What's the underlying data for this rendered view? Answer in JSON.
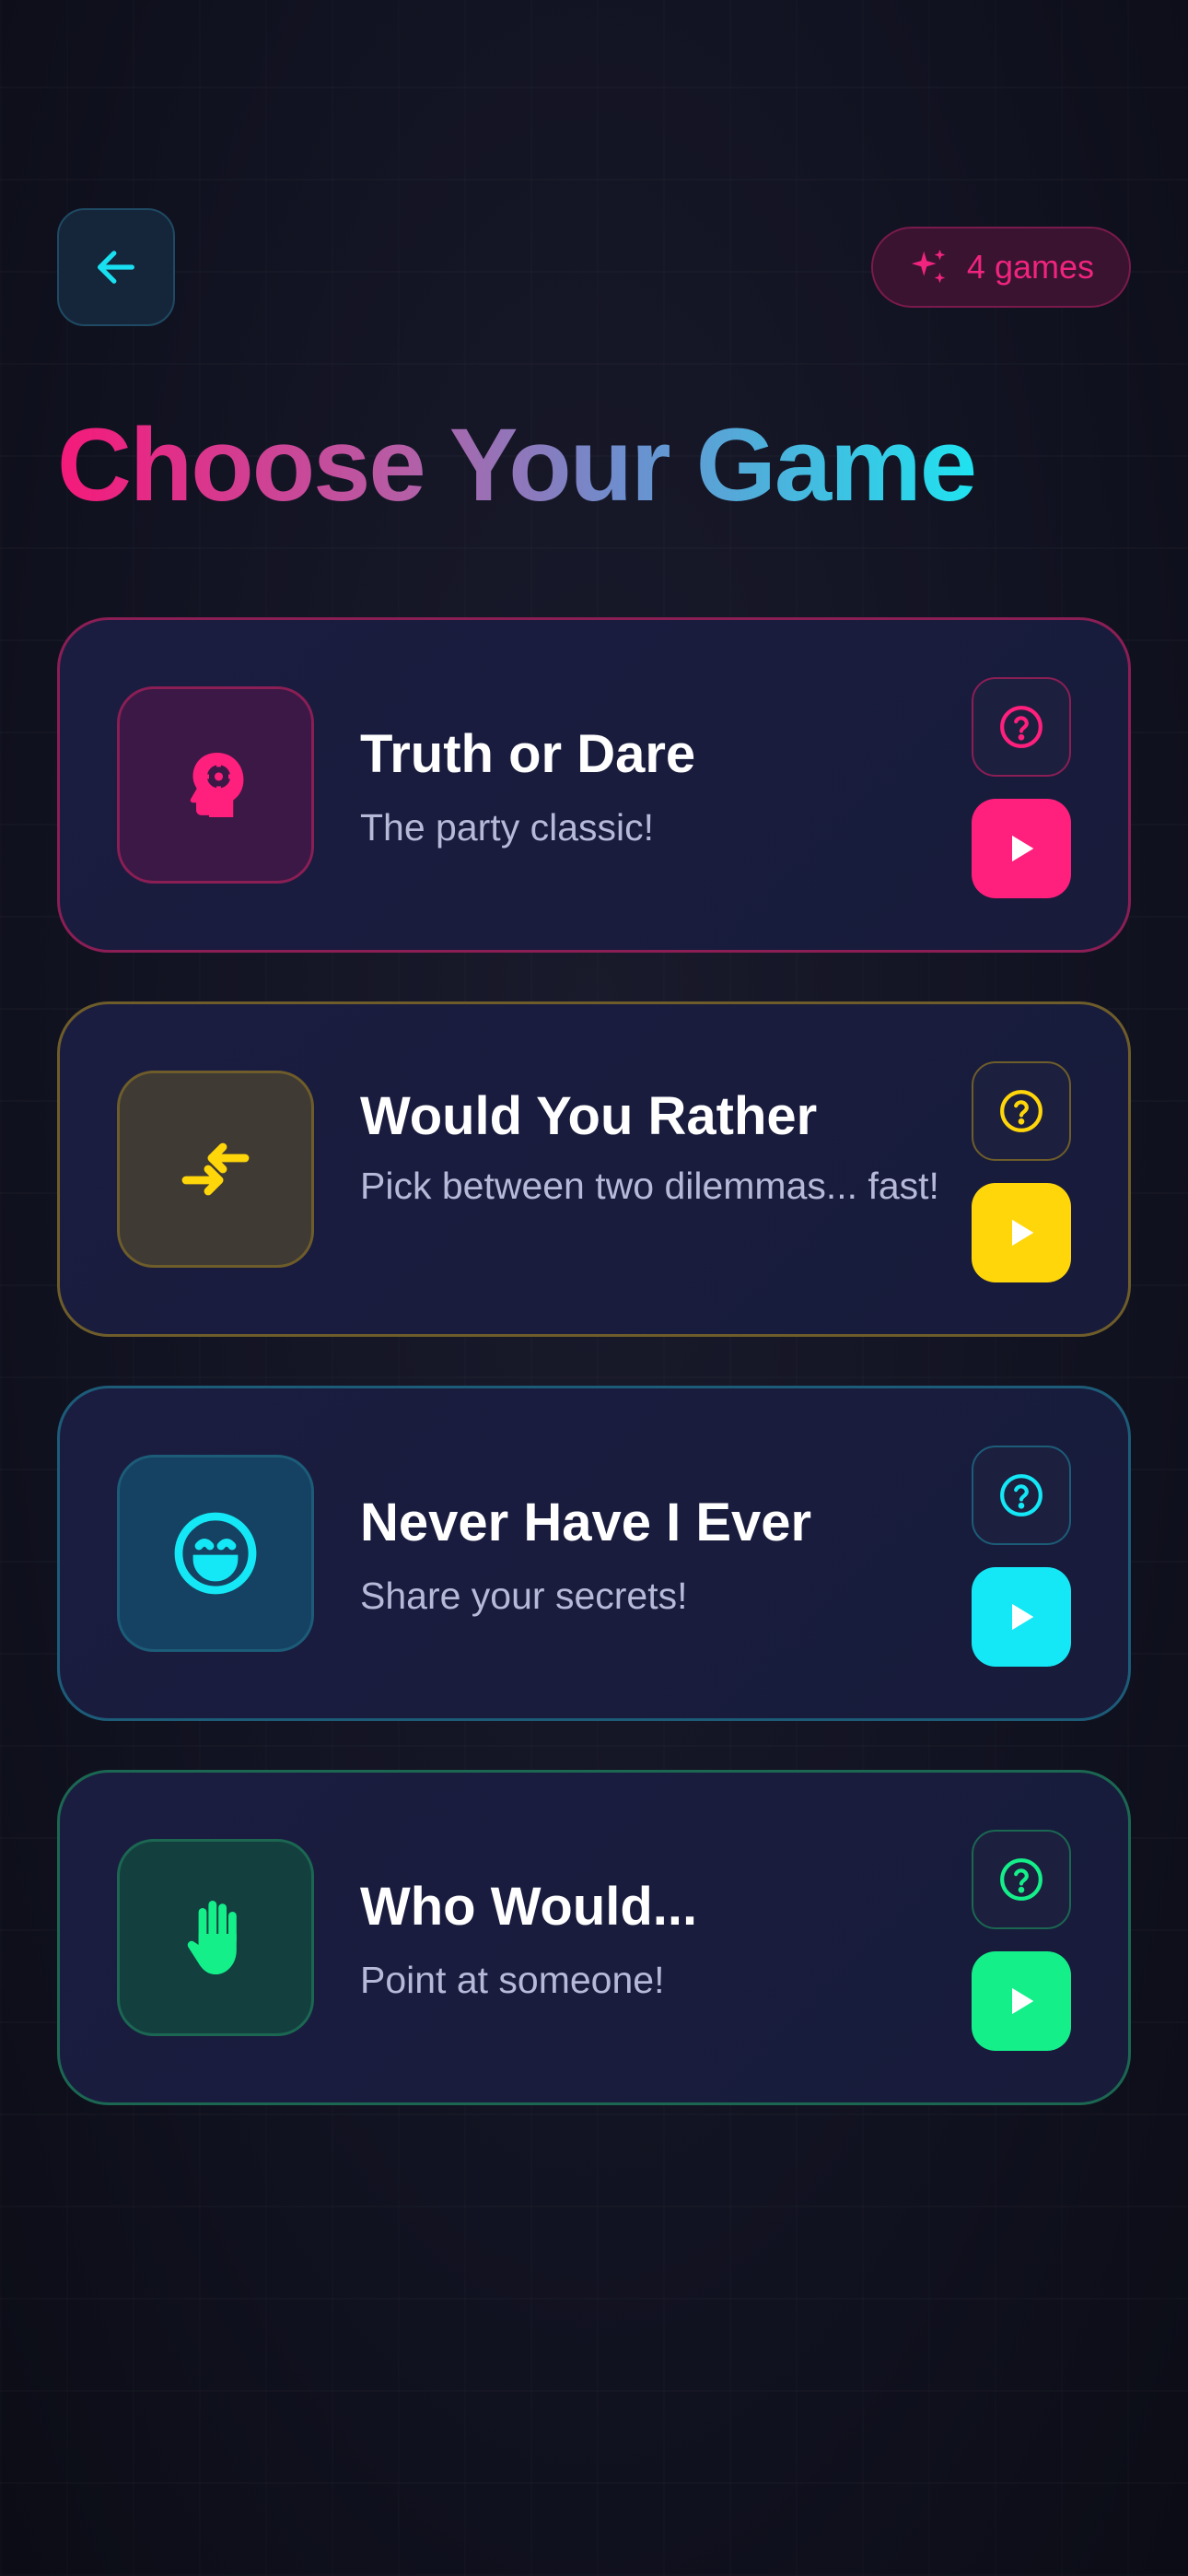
{
  "header": {
    "back_icon": "arrow-left-icon",
    "badge": {
      "icon": "sparkles-icon",
      "label": "4 games"
    },
    "title": "Choose Your Game"
  },
  "games": [
    {
      "title": "Truth or Dare",
      "subtitle": "The party classic!",
      "icon": "head-gear-icon",
      "accent": "#ff1f7c",
      "icon_bg": "#3b1845",
      "border": "#8a1e55",
      "help_icon": "question-circle-icon",
      "play_icon": "play-icon"
    },
    {
      "title": "Would You Rather",
      "subtitle": "Pick between two dilemmas... fast!",
      "icon": "swap-arrows-icon",
      "accent": "#ffd60a",
      "icon_bg": "#3f3a34",
      "border": "#6e5d2a",
      "help_icon": "question-circle-icon",
      "play_icon": "play-icon"
    },
    {
      "title": "Never Have I Ever",
      "subtitle": "Share your secrets!",
      "icon": "smile-icon",
      "accent": "#14e7f5",
      "icon_bg": "#154262",
      "border": "#1c5c78",
      "help_icon": "question-circle-icon",
      "play_icon": "play-icon"
    },
    {
      "title": "Who Would...",
      "subtitle": "Point at someone!",
      "icon": "raised-hand-icon",
      "accent": "#14ef8a",
      "icon_bg": "#13403f",
      "border": "#1b6752",
      "help_icon": "question-circle-icon",
      "play_icon": "play-icon"
    }
  ]
}
